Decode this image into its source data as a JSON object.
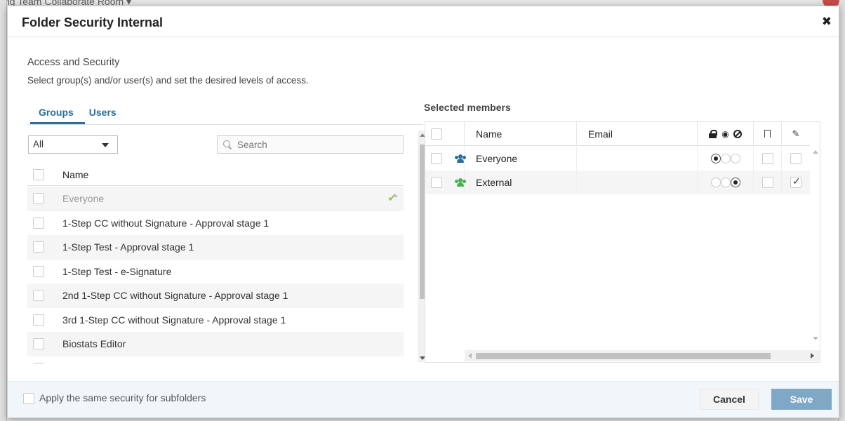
{
  "background": {
    "partial_title": "ng Team Collaborate Room ▾"
  },
  "modal": {
    "title": "Folder Security Internal",
    "close_label": "✖",
    "section_title": "Access and Security",
    "section_subtitle": "Select group(s) and/or user(s) and set the desired levels of access."
  },
  "tabs": [
    {
      "label": "Groups",
      "active": true
    },
    {
      "label": "Users",
      "active": false
    }
  ],
  "filter": {
    "selected": "All"
  },
  "search": {
    "placeholder": "Search"
  },
  "groups_grid": {
    "header_name": "Name",
    "rows": [
      {
        "label": "Everyone",
        "disabled": true,
        "checked_mark": "✔"
      },
      {
        "label": "1-Step CC without Signature - Approval stage 1"
      },
      {
        "label": "1-Step Test - Approval stage 1"
      },
      {
        "label": "1-Step Test - e-Signature"
      },
      {
        "label": "2nd 1-Step CC without Signature - Approval stage 1"
      },
      {
        "label": "3rd 1-Step CC without Signature - Approval stage 1"
      },
      {
        "label": "Biostats Editor"
      }
    ]
  },
  "selected_members": {
    "title": "Selected members",
    "headers": {
      "name": "Name",
      "email": "Email"
    },
    "rows": [
      {
        "name": "Everyone",
        "email": "",
        "icon": "group-icon",
        "icon_color": "#2a6f99",
        "permission": "restricted",
        "flag": false,
        "edit": false
      },
      {
        "name": "External",
        "email": "",
        "icon": "group-icon",
        "icon_color": "#4caf50",
        "permission": "none",
        "flag": false,
        "edit": true
      }
    ]
  },
  "footer": {
    "apply_subfolders_label": "Apply the same security for subfolders",
    "cancel_label": "Cancel",
    "save_label": "Save"
  },
  "colors": {
    "accent": "#2a6f99",
    "save_button": "#7fa8c6",
    "footer_bg": "#f0f6f9",
    "check_green": "#8bc34a"
  }
}
